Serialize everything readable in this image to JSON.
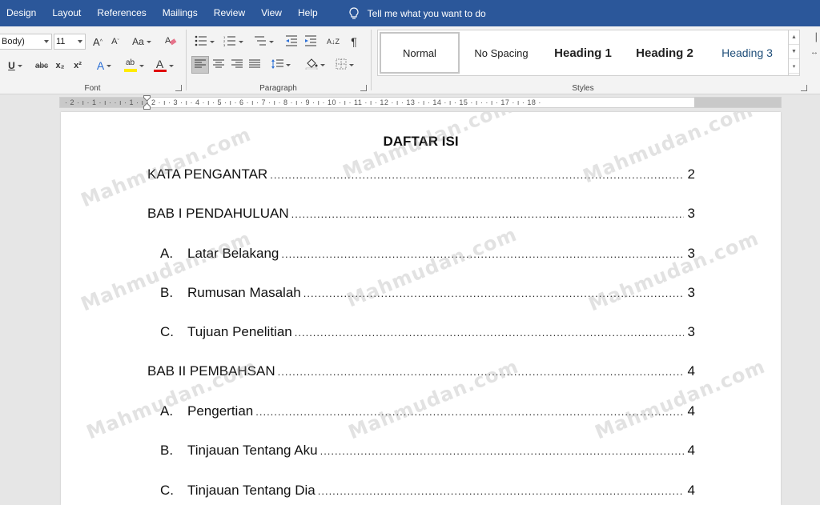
{
  "menu": {
    "tabs": [
      "Design",
      "Layout",
      "References",
      "Mailings",
      "Review",
      "View",
      "Help"
    ],
    "tell_me": "Tell me what you want to do"
  },
  "font_group": {
    "font_name": "Body)",
    "font_size": "11",
    "grow_label": "A",
    "shrink_label": "A",
    "case_label": "Aa",
    "underline_label": "U",
    "strike_label": "abc",
    "subscript_label": "x₂",
    "superscript_label": "x²",
    "effects_label": "A",
    "highlight_label": "ab",
    "color_label": "A",
    "highlight_color": "#ffeb00",
    "font_color": "#e00000",
    "label": "Font"
  },
  "paragraph_group": {
    "label": "Paragraph",
    "pilcrow": "¶",
    "sort_label": "A↓Z"
  },
  "styles_group": {
    "label": "Styles",
    "items": [
      "Normal",
      "No Spacing",
      "Heading 1",
      "Heading 2",
      "Heading 3"
    ]
  },
  "ruler": {
    "marks": "· 2 · ı · 1 · ı ·   · ı · 1 · ı · 2 · ı · 3 · ı · 4 · ı · 5 · ı · 6 · ı · 7 · ı · 8 · ı · 9 · ı · 10 · ı · 11 · ı · 12 · ı · 13 · ı · 14 · ı · 15 · ı ·   · ı · 17 · ı · 18 ·"
  },
  "document": {
    "title": "DAFTAR ISI",
    "toc": [
      {
        "letter": "",
        "text": "KATA PENGANTAR",
        "page": "2",
        "level": 0
      },
      {
        "letter": "",
        "text": "BAB I PENDAHULUAN",
        "page": "3",
        "level": 0
      },
      {
        "letter": "A.",
        "text": "Latar Belakang",
        "page": "3",
        "level": 1
      },
      {
        "letter": "B.",
        "text": "Rumusan Masalah",
        "page": "3",
        "level": 1
      },
      {
        "letter": "C.",
        "text": "Tujuan Penelitian",
        "page": "3",
        "level": 1
      },
      {
        "letter": "",
        "text": "BAB II PEMBAHSAN",
        "page": "4",
        "level": 0
      },
      {
        "letter": "A.",
        "text": "Pengertian",
        "page": "4",
        "level": 1
      },
      {
        "letter": "B.",
        "text": "Tinjauan Tentang Aku",
        "page": "4",
        "level": 1
      },
      {
        "letter": "C.",
        "text": "Tinjauan Tentang Dia",
        "page": "4",
        "level": 1
      }
    ]
  },
  "watermark": {
    "text": "Mahmudan.com"
  },
  "colors": {
    "menubar": "#2b579a",
    "ribbon": "#f3f3f3",
    "canvas": "#e6e6e6"
  }
}
